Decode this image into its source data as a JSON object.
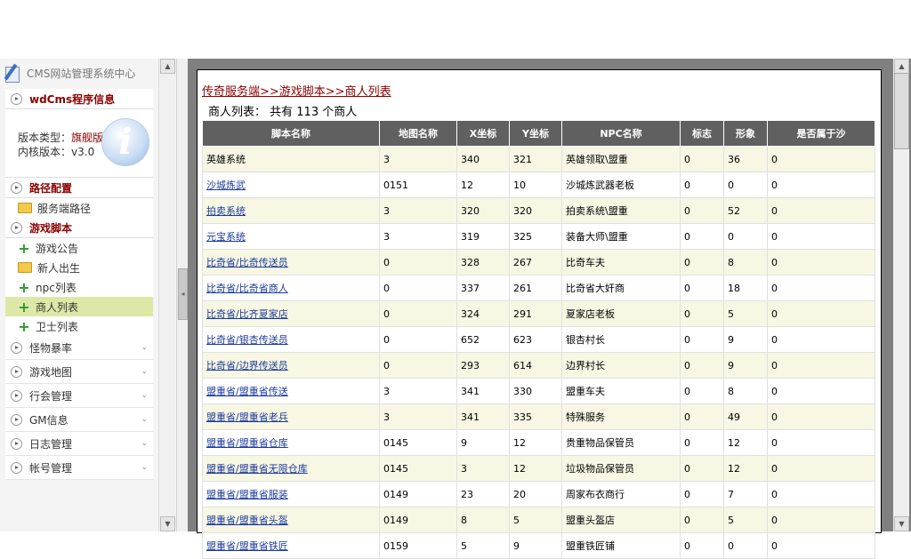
{
  "sidebar": {
    "title": "CMS网站管理系统中心",
    "sections": {
      "info": {
        "title": "wdCms程序信息",
        "version_type_label": "版本类型：",
        "version_type": "旗舰版",
        "kernel_label": "内核版本：",
        "kernel": "v3.0"
      },
      "path": {
        "title": "路径配置",
        "items": [
          "服务端路径"
        ]
      },
      "script": {
        "title": "游戏脚本",
        "items": [
          "游戏公告",
          "新人出生",
          "npc列表",
          "商人列表",
          "卫士列表"
        ]
      },
      "others": [
        "怪物暴率",
        "游戏地图",
        "行会管理",
        "GM信息",
        "日志管理",
        "帐号管理"
      ]
    }
  },
  "main": {
    "breadcrumb": "传奇服务端>>游戏脚本>>商人列表",
    "count_prefix": "商人列表：  共有",
    "count": "113",
    "count_suffix": "个商人",
    "headers": [
      "脚本名称",
      "地图名称",
      "X坐标",
      "Y坐标",
      "NPC名称",
      "标志",
      "形象",
      "是否属于沙"
    ],
    "rows": [
      [
        "英雄系统",
        "3",
        "340",
        "321",
        "英雄领取\\盟重",
        "0",
        "36",
        "0"
      ],
      [
        "沙城炼武",
        "0151",
        "12",
        "10",
        "沙城炼武器老板",
        "0",
        "0",
        "0"
      ],
      [
        "拍卖系统",
        "3",
        "320",
        "320",
        "拍卖系统\\盟重",
        "0",
        "52",
        "0"
      ],
      [
        "元宝系统",
        "3",
        "319",
        "325",
        "装备大师\\盟重",
        "0",
        "0",
        "0"
      ],
      [
        "比奇省/比奇传送员",
        "0",
        "328",
        "267",
        "比奇车夫",
        "0",
        "8",
        "0"
      ],
      [
        "比奇省/比奇省商人",
        "0",
        "337",
        "261",
        "比奇省大奸商",
        "0",
        "18",
        "0"
      ],
      [
        "比奇省/比齐夏家店",
        "0",
        "324",
        "291",
        "夏家店老板",
        "0",
        "5",
        "0"
      ],
      [
        "比奇省/银杏传送员",
        "0",
        "652",
        "623",
        "银杏村长",
        "0",
        "9",
        "0"
      ],
      [
        "比奇省/边界传送员",
        "0",
        "293",
        "614",
        "边界村长",
        "0",
        "9",
        "0"
      ],
      [
        "盟重省/盟重省传送",
        "3",
        "341",
        "330",
        "盟重车夫",
        "0",
        "8",
        "0"
      ],
      [
        "盟重省/盟重省老兵",
        "3",
        "341",
        "335",
        "特殊服务",
        "0",
        "49",
        "0"
      ],
      [
        "盟重省/盟重省仓库",
        "0145",
        "9",
        "12",
        "贵重物品保管员",
        "0",
        "12",
        "0"
      ],
      [
        "盟重省/盟重省无限仓库",
        "0145",
        "3",
        "12",
        "垃圾物品保管员",
        "0",
        "12",
        "0"
      ],
      [
        "盟重省/盟重省服装",
        "0149",
        "23",
        "20",
        "周家布衣商行",
        "0",
        "7",
        "0"
      ],
      [
        "盟重省/盟重省头盔",
        "0149",
        "8",
        "5",
        "盟重头盔店",
        "0",
        "5",
        "0"
      ],
      [
        "盟重省/盟重省铁匠",
        "0159",
        "5",
        "9",
        "盟重铁匠铺",
        "0",
        "0",
        "0"
      ]
    ]
  }
}
